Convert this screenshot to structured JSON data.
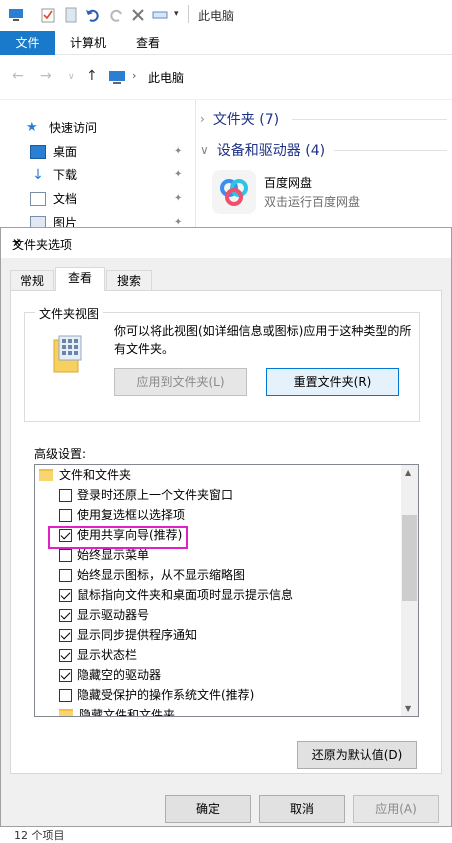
{
  "explorer": {
    "title": "此电脑",
    "ribbon_tabs": [
      "文件",
      "计算机",
      "查看"
    ],
    "breadcrumb": "此电脑",
    "sidebar": [
      {
        "label": "快速访问",
        "icon": "star-icon"
      },
      {
        "label": "桌面",
        "icon": "desktop-icon"
      },
      {
        "label": "下载",
        "icon": "download-icon"
      },
      {
        "label": "文档",
        "icon": "document-icon"
      },
      {
        "label": "图片",
        "icon": "picture-icon"
      }
    ],
    "groups": [
      "文件夹 (7)",
      "设备和驱动器 (4)"
    ],
    "drive": {
      "name": "百度网盘",
      "desc": "双击运行百度网盘"
    },
    "status": "12 个项目"
  },
  "dialog": {
    "title": "文件夹选项",
    "tabs": [
      "常规",
      "查看",
      "搜索"
    ],
    "folder_view": {
      "label": "文件夹视图",
      "description": "你可以将此视图(如详细信息或图标)应用于这种类型的所有文件夹。",
      "apply_btn": "应用到文件夹(L)",
      "reset_btn": "重置文件夹(R)"
    },
    "advanced_label": "高级设置:",
    "items": [
      {
        "label": "文件和文件夹",
        "type": "folder"
      },
      {
        "label": "登录时还原上一个文件夹窗口",
        "type": "checkbox",
        "checked": false
      },
      {
        "label": "使用复选框以选择项",
        "type": "checkbox",
        "checked": false
      },
      {
        "label": "使用共享向导(推荐)",
        "type": "checkbox",
        "checked": true
      },
      {
        "label": "始终显示菜单",
        "type": "checkbox",
        "checked": false
      },
      {
        "label": "始终显示图标，从不显示缩略图",
        "type": "checkbox",
        "checked": false
      },
      {
        "label": "鼠标指向文件夹和桌面项时显示提示信息",
        "type": "checkbox",
        "checked": true
      },
      {
        "label": "显示驱动器号",
        "type": "checkbox",
        "checked": true
      },
      {
        "label": "显示同步提供程序通知",
        "type": "checkbox",
        "checked": true
      },
      {
        "label": "显示状态栏",
        "type": "checkbox",
        "checked": true
      },
      {
        "label": "隐藏空的驱动器",
        "type": "checkbox",
        "checked": true
      },
      {
        "label": "隐藏受保护的操作系统文件(推荐)",
        "type": "checkbox",
        "checked": false
      },
      {
        "label": "隐藏文件和文件夹",
        "type": "folder"
      }
    ],
    "restore_btn": "还原为默认值(D)",
    "ok_btn": "确定",
    "cancel_btn": "取消",
    "apply_btn": "应用(A)"
  }
}
